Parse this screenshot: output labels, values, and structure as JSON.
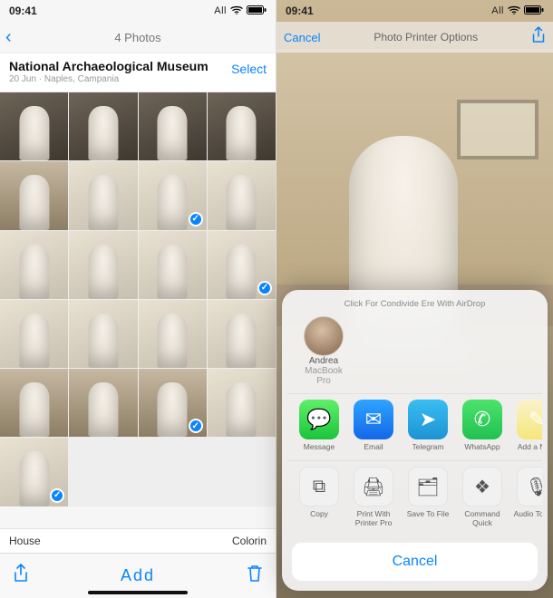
{
  "status": {
    "time": "09:41",
    "carrier": "All",
    "wifi_icon": "wifi",
    "battery": 100
  },
  "left": {
    "nav_title": "4 Photos",
    "album_title": "National Archaeological Museum",
    "album_subtitle": "20 Jun · Naples, Campania",
    "select_label": "Select",
    "grid": [
      {
        "sel": false,
        "tone": "dark"
      },
      {
        "sel": false,
        "tone": "dark"
      },
      {
        "sel": false,
        "tone": "dark"
      },
      {
        "sel": false,
        "tone": "dark"
      },
      {
        "sel": false,
        "tone": "floor"
      },
      {
        "sel": false,
        "tone": "light"
      },
      {
        "sel": true,
        "tone": "light"
      },
      {
        "sel": false,
        "tone": "light"
      },
      {
        "sel": false,
        "tone": "light"
      },
      {
        "sel": false,
        "tone": "light"
      },
      {
        "sel": false,
        "tone": "light"
      },
      {
        "sel": true,
        "tone": "light"
      },
      {
        "sel": false,
        "tone": "light"
      },
      {
        "sel": false,
        "tone": "light"
      },
      {
        "sel": false,
        "tone": "light"
      },
      {
        "sel": false,
        "tone": "light"
      },
      {
        "sel": false,
        "tone": "floor"
      },
      {
        "sel": false,
        "tone": "floor"
      },
      {
        "sel": true,
        "tone": "floor"
      },
      {
        "sel": false,
        "tone": "light"
      },
      {
        "sel": true,
        "tone": "light"
      }
    ],
    "bottom_left": "House",
    "bottom_right": "Colorin",
    "toolbar": {
      "share_icon": "share",
      "add_label": "Add",
      "trash_icon": "trash"
    }
  },
  "right": {
    "nav_cancel": "Cancel",
    "nav_title": "Photo Printer Options",
    "share_icon": "share",
    "sheet": {
      "header": "Click For Condivide Ere With AirDrop",
      "airdrop": {
        "name": "Andrea",
        "device": "MacBook Pro"
      },
      "apps": [
        {
          "id": "message",
          "label": "Message",
          "glyph": "💬",
          "cls": "msg"
        },
        {
          "id": "email",
          "label": "Email",
          "glyph": "✉",
          "cls": "mail"
        },
        {
          "id": "telegram",
          "label": "Telegram",
          "glyph": "➤",
          "cls": "tg"
        },
        {
          "id": "whatsapp",
          "label": "WhatsApp",
          "glyph": "✆",
          "cls": "wa"
        },
        {
          "id": "addnote",
          "label": "Add a Note",
          "glyph": "✎",
          "cls": "note"
        }
      ],
      "actions": [
        {
          "id": "copy",
          "label": "Copy",
          "glyph": "⧉"
        },
        {
          "id": "print",
          "label": "Print With Printer Pro",
          "glyph": "🖨"
        },
        {
          "id": "savefile",
          "label": "Save To File",
          "glyph": "🗂"
        },
        {
          "id": "command",
          "label": "Command Quick",
          "glyph": "❖"
        },
        {
          "id": "audiotext",
          "label": "Audio To Text",
          "glyph": "🎙"
        }
      ],
      "cancel": "Cancel"
    }
  }
}
